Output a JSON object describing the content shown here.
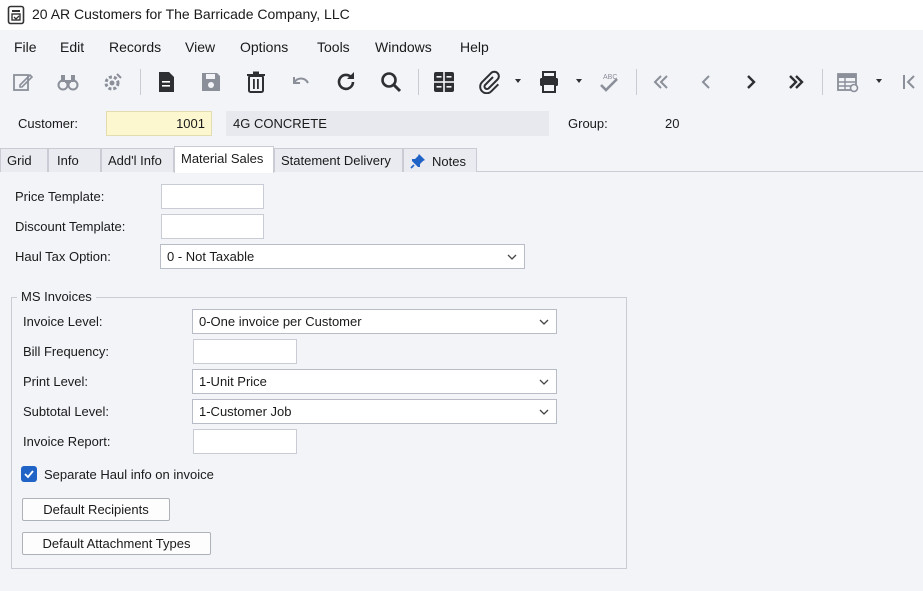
{
  "window": {
    "title": "20 AR Customers for The Barricade Company, LLC",
    "icon": "form-icon"
  },
  "menu": [
    "File",
    "Edit",
    "Records",
    "View",
    "Options",
    "Tools",
    "Windows",
    "Help"
  ],
  "toolbar": {
    "icons": [
      "edit-icon",
      "binoculars-icon",
      "settings-gear-icon",
      "new-document-icon",
      "save-icon",
      "delete-icon",
      "undo-icon",
      "refresh-icon",
      "search-icon",
      "grid-icon",
      "attachment-icon",
      "print-icon",
      "spellcheck-icon",
      "first-record-icon",
      "previous-record-icon",
      "next-record-icon",
      "last-record-icon",
      "grid-settings-icon",
      "collapse-left-icon"
    ]
  },
  "header": {
    "customer_label": "Customer:",
    "customer_value": "1001",
    "customer_name": "4G CONCRETE",
    "group_label": "Group:",
    "group_value": "20"
  },
  "tabs": [
    "Grid",
    "Info",
    "Add'l Info",
    "Material Sales",
    "Statement Delivery",
    "Notes"
  ],
  "active_tab": "Material Sales",
  "form": {
    "price_template_label": "Price Template:",
    "price_template_value": "",
    "discount_template_label": "Discount Template:",
    "discount_template_value": "",
    "haul_tax_label": "Haul Tax Option:",
    "haul_tax_value": "0 - Not Taxable"
  },
  "ms_invoices": {
    "title": "MS Invoices",
    "invoice_level_label": "Invoice Level:",
    "invoice_level_value": "0-One invoice per Customer",
    "bill_frequency_label": "Bill Frequency:",
    "bill_frequency_value": "",
    "print_level_label": "Print Level:",
    "print_level_value": "1-Unit Price",
    "subtotal_level_label": "Subtotal Level:",
    "subtotal_level_value": "1-Customer Job",
    "invoice_report_label": "Invoice Report:",
    "invoice_report_value": "",
    "separate_haul_label": "Separate Haul info on invoice",
    "separate_haul_checked": true,
    "default_recipients_label": "Default Recipients",
    "default_attachment_types_label": "Default Attachment Types"
  },
  "colors": {
    "accent": "#1f63c6",
    "customer_field": "#fdf7cf",
    "background": "#f3f4f8"
  }
}
